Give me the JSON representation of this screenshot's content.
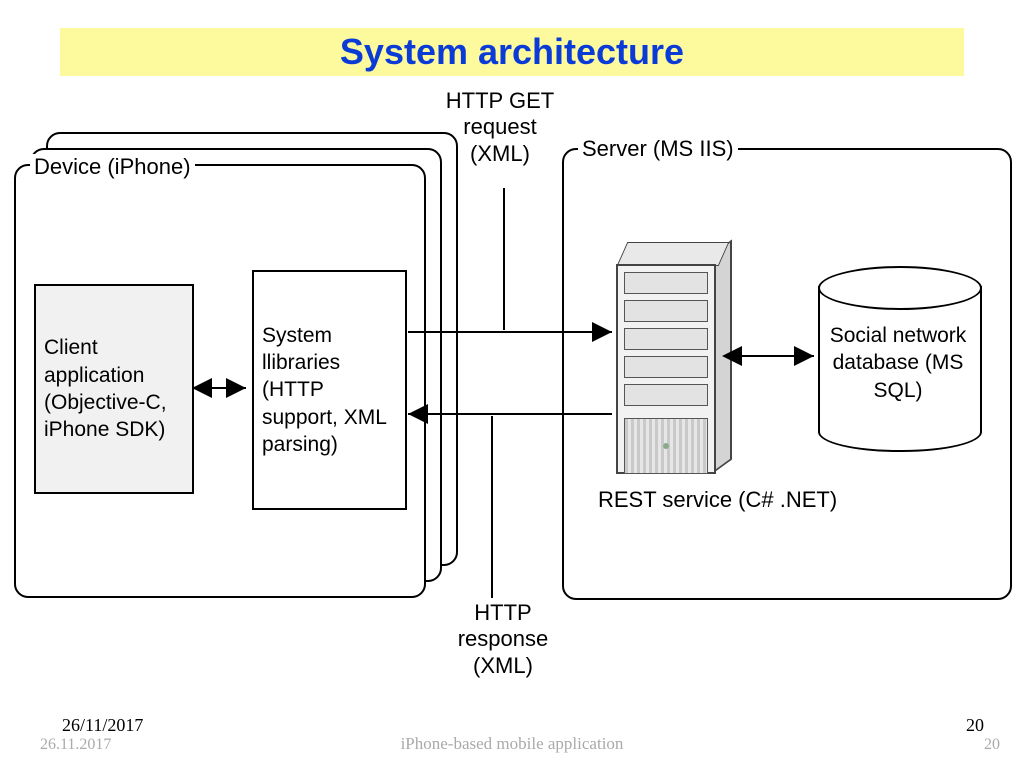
{
  "title": "System architecture",
  "device_legend": "Device (iPhone)",
  "server_legend": "Server (MS IIS)",
  "client_box": "Client application (Objective-C, iPhone SDK)",
  "syslib_box": "System llibraries (HTTP support, XML parsing)",
  "http_get_label": "HTTP GET request (XML)",
  "http_resp_label": "HTTP response (XML)",
  "rest_label": "REST service (C# .NET)",
  "db_label": "Social network database (MS SQL)",
  "footer": {
    "date_top": "26/11/2017",
    "page_top": "20",
    "date_bottom": "26.11.2017",
    "title": "iPhone-based mobile application",
    "page_bottom": "20"
  }
}
